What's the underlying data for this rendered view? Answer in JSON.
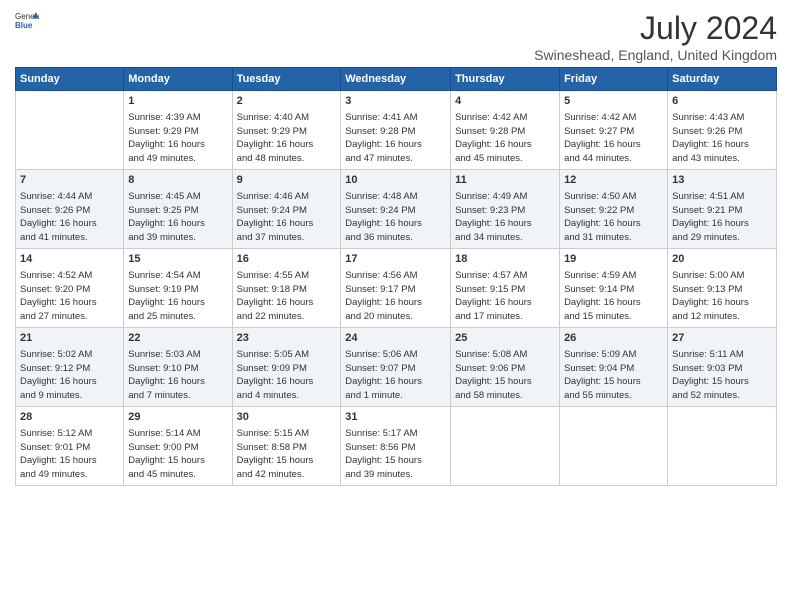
{
  "logo": {
    "general": "General",
    "blue": "Blue"
  },
  "title": "July 2024",
  "subtitle": "Swineshead, England, United Kingdom",
  "headers": [
    "Sunday",
    "Monday",
    "Tuesday",
    "Wednesday",
    "Thursday",
    "Friday",
    "Saturday"
  ],
  "weeks": [
    [
      {
        "day": "",
        "lines": []
      },
      {
        "day": "1",
        "lines": [
          "Sunrise: 4:39 AM",
          "Sunset: 9:29 PM",
          "Daylight: 16 hours",
          "and 49 minutes."
        ]
      },
      {
        "day": "2",
        "lines": [
          "Sunrise: 4:40 AM",
          "Sunset: 9:29 PM",
          "Daylight: 16 hours",
          "and 48 minutes."
        ]
      },
      {
        "day": "3",
        "lines": [
          "Sunrise: 4:41 AM",
          "Sunset: 9:28 PM",
          "Daylight: 16 hours",
          "and 47 minutes."
        ]
      },
      {
        "day": "4",
        "lines": [
          "Sunrise: 4:42 AM",
          "Sunset: 9:28 PM",
          "Daylight: 16 hours",
          "and 45 minutes."
        ]
      },
      {
        "day": "5",
        "lines": [
          "Sunrise: 4:42 AM",
          "Sunset: 9:27 PM",
          "Daylight: 16 hours",
          "and 44 minutes."
        ]
      },
      {
        "day": "6",
        "lines": [
          "Sunrise: 4:43 AM",
          "Sunset: 9:26 PM",
          "Daylight: 16 hours",
          "and 43 minutes."
        ]
      }
    ],
    [
      {
        "day": "7",
        "lines": [
          "Sunrise: 4:44 AM",
          "Sunset: 9:26 PM",
          "Daylight: 16 hours",
          "and 41 minutes."
        ]
      },
      {
        "day": "8",
        "lines": [
          "Sunrise: 4:45 AM",
          "Sunset: 9:25 PM",
          "Daylight: 16 hours",
          "and 39 minutes."
        ]
      },
      {
        "day": "9",
        "lines": [
          "Sunrise: 4:46 AM",
          "Sunset: 9:24 PM",
          "Daylight: 16 hours",
          "and 37 minutes."
        ]
      },
      {
        "day": "10",
        "lines": [
          "Sunrise: 4:48 AM",
          "Sunset: 9:24 PM",
          "Daylight: 16 hours",
          "and 36 minutes."
        ]
      },
      {
        "day": "11",
        "lines": [
          "Sunrise: 4:49 AM",
          "Sunset: 9:23 PM",
          "Daylight: 16 hours",
          "and 34 minutes."
        ]
      },
      {
        "day": "12",
        "lines": [
          "Sunrise: 4:50 AM",
          "Sunset: 9:22 PM",
          "Daylight: 16 hours",
          "and 31 minutes."
        ]
      },
      {
        "day": "13",
        "lines": [
          "Sunrise: 4:51 AM",
          "Sunset: 9:21 PM",
          "Daylight: 16 hours",
          "and 29 minutes."
        ]
      }
    ],
    [
      {
        "day": "14",
        "lines": [
          "Sunrise: 4:52 AM",
          "Sunset: 9:20 PM",
          "Daylight: 16 hours",
          "and 27 minutes."
        ]
      },
      {
        "day": "15",
        "lines": [
          "Sunrise: 4:54 AM",
          "Sunset: 9:19 PM",
          "Daylight: 16 hours",
          "and 25 minutes."
        ]
      },
      {
        "day": "16",
        "lines": [
          "Sunrise: 4:55 AM",
          "Sunset: 9:18 PM",
          "Daylight: 16 hours",
          "and 22 minutes."
        ]
      },
      {
        "day": "17",
        "lines": [
          "Sunrise: 4:56 AM",
          "Sunset: 9:17 PM",
          "Daylight: 16 hours",
          "and 20 minutes."
        ]
      },
      {
        "day": "18",
        "lines": [
          "Sunrise: 4:57 AM",
          "Sunset: 9:15 PM",
          "Daylight: 16 hours",
          "and 17 minutes."
        ]
      },
      {
        "day": "19",
        "lines": [
          "Sunrise: 4:59 AM",
          "Sunset: 9:14 PM",
          "Daylight: 16 hours",
          "and 15 minutes."
        ]
      },
      {
        "day": "20",
        "lines": [
          "Sunrise: 5:00 AM",
          "Sunset: 9:13 PM",
          "Daylight: 16 hours",
          "and 12 minutes."
        ]
      }
    ],
    [
      {
        "day": "21",
        "lines": [
          "Sunrise: 5:02 AM",
          "Sunset: 9:12 PM",
          "Daylight: 16 hours",
          "and 9 minutes."
        ]
      },
      {
        "day": "22",
        "lines": [
          "Sunrise: 5:03 AM",
          "Sunset: 9:10 PM",
          "Daylight: 16 hours",
          "and 7 minutes."
        ]
      },
      {
        "day": "23",
        "lines": [
          "Sunrise: 5:05 AM",
          "Sunset: 9:09 PM",
          "Daylight: 16 hours",
          "and 4 minutes."
        ]
      },
      {
        "day": "24",
        "lines": [
          "Sunrise: 5:06 AM",
          "Sunset: 9:07 PM",
          "Daylight: 16 hours",
          "and 1 minute."
        ]
      },
      {
        "day": "25",
        "lines": [
          "Sunrise: 5:08 AM",
          "Sunset: 9:06 PM",
          "Daylight: 15 hours",
          "and 58 minutes."
        ]
      },
      {
        "day": "26",
        "lines": [
          "Sunrise: 5:09 AM",
          "Sunset: 9:04 PM",
          "Daylight: 15 hours",
          "and 55 minutes."
        ]
      },
      {
        "day": "27",
        "lines": [
          "Sunrise: 5:11 AM",
          "Sunset: 9:03 PM",
          "Daylight: 15 hours",
          "and 52 minutes."
        ]
      }
    ],
    [
      {
        "day": "28",
        "lines": [
          "Sunrise: 5:12 AM",
          "Sunset: 9:01 PM",
          "Daylight: 15 hours",
          "and 49 minutes."
        ]
      },
      {
        "day": "29",
        "lines": [
          "Sunrise: 5:14 AM",
          "Sunset: 9:00 PM",
          "Daylight: 15 hours",
          "and 45 minutes."
        ]
      },
      {
        "day": "30",
        "lines": [
          "Sunrise: 5:15 AM",
          "Sunset: 8:58 PM",
          "Daylight: 15 hours",
          "and 42 minutes."
        ]
      },
      {
        "day": "31",
        "lines": [
          "Sunrise: 5:17 AM",
          "Sunset: 8:56 PM",
          "Daylight: 15 hours",
          "and 39 minutes."
        ]
      },
      {
        "day": "",
        "lines": []
      },
      {
        "day": "",
        "lines": []
      },
      {
        "day": "",
        "lines": []
      }
    ]
  ]
}
